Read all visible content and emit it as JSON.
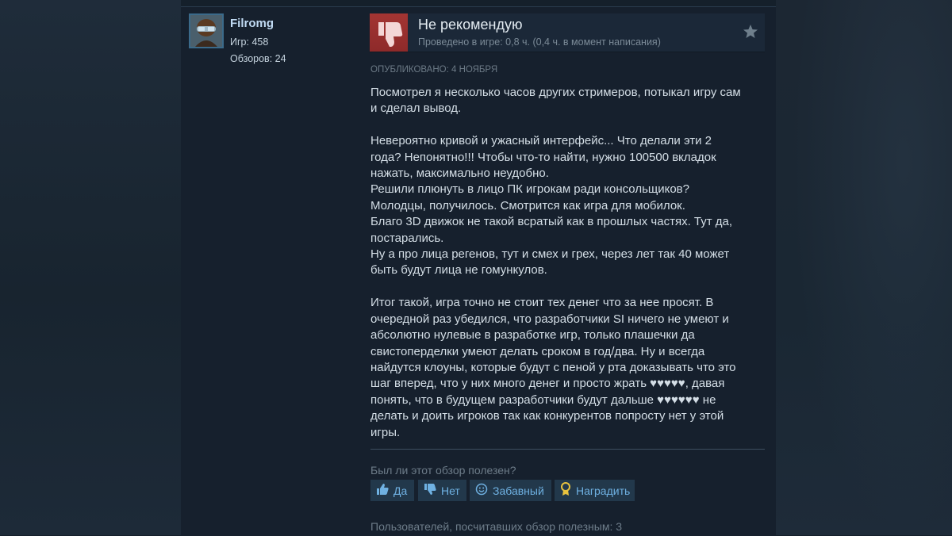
{
  "user": {
    "name": "Filromg",
    "games": "Игр: 458",
    "reviews": "Обзоров: 24"
  },
  "review": {
    "verdict": "Не рекомендую",
    "playtime": "Проведено в игре: 0,8 ч. (0,4 ч. в момент написания)",
    "posted": "ОПУБЛИКОВАНО: 4 НОЯБРЯ",
    "text": "Посмотрел я несколько часов других стримеров, потыкал игру сам\nи сделал вывод.\n\nНевероятно кривой и ужасный интерфейс... Что делали эти 2\nгода? Непонятно!!! Чтобы что-то найти, нужно 100500 вкладок\nнажать, максимально неудобно.\nРешили плюнуть в лицо ПК игрокам ради консольщиков?\nМолодцы, получилось. Смотрится как игра для мобилок.\nБлаго 3D движок не такой всратый как в прошлых частях. Тут да,\nпостарались.\nНу а про лица регенов, тут и смех и грех, через лет так 40 может\nбыть будут лица не гомункулов.\n\nИтог такой, игра точно не стоит тех денег что за нее просят. В\nочередной раз убедился, что разработчики SI ничего не умеют и\nабсолютно нулевые в разработке игр, только плашечки да\nсвистоперделки умеют делать сроком в год/два. Ну и всегда\nнайдутся клоуны, которые будут с пеной у рта доказывать что это\nшаг вперед, что у них много денег и просто жрать ♥♥♥♥♥, давая\nпонять, что в будущем разработчики будут дальше ♥♥♥♥♥♥ не\nделать и доить игроков так как конкурентов попросту нет у этой\nигры."
  },
  "feedback": {
    "question": "Был ли этот обзор полезен?",
    "yes": "Да",
    "no": "Нет",
    "funny": "Забавный",
    "award": "Наградить",
    "helpful_count": "Пользователей, посчитавших обзор полезным: 3"
  },
  "icons": {
    "verdict": "thumbs-down-icon",
    "favorite": "star-icon",
    "yes": "thumbs-up-icon",
    "no": "thumbs-down-icon",
    "funny": "smiley-icon",
    "award": "award-icon"
  },
  "colors": {
    "negative": "#a33533",
    "link": "#6fb1e2",
    "button_bg": "#22384b",
    "award": "#e8c23e"
  }
}
